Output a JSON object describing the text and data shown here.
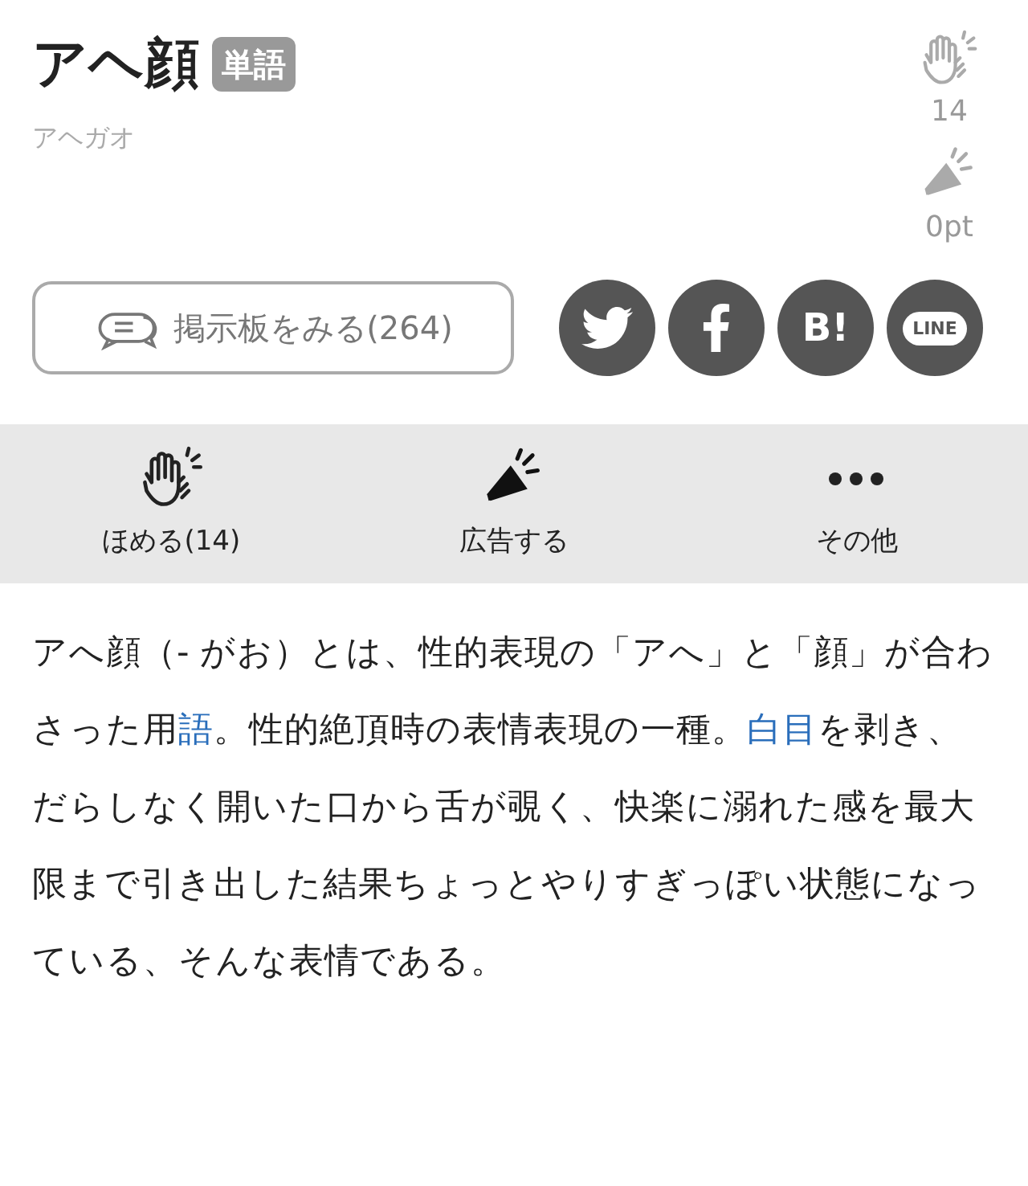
{
  "title": "アヘ顔",
  "badge": "単語",
  "reading": "アヘガオ",
  "stats": [
    {
      "kind": "praise",
      "value": "14"
    },
    {
      "kind": "ad",
      "value": "0pt"
    }
  ],
  "board_button": {
    "label": "掲示板をみる",
    "count": "(264)"
  },
  "share": [
    {
      "kind": "twitter"
    },
    {
      "kind": "facebook"
    },
    {
      "kind": "hatena",
      "label": "B!"
    },
    {
      "kind": "line",
      "label": "LINE"
    }
  ],
  "actions": [
    {
      "kind": "praise",
      "label": "ほめる(14)"
    },
    {
      "kind": "ad",
      "label": "広告する"
    },
    {
      "kind": "more",
      "label": "その他"
    }
  ],
  "body": [
    {
      "text": "アへ顔（- がお）とは、性的表現の「アへ」と「顔」が合わさった用",
      "link": false
    },
    {
      "text": "語",
      "link": true
    },
    {
      "text": "。性的絶頂時の表情表現の一種。",
      "link": false
    },
    {
      "text": "白目",
      "link": true
    },
    {
      "text": "を剥き、だらしなく開いた口から舌が覗く、快楽に溺れた感を最大限まで引き出した結果ちょっとやりすぎっぽい状態になっている、そんな表情である。",
      "link": false
    }
  ]
}
